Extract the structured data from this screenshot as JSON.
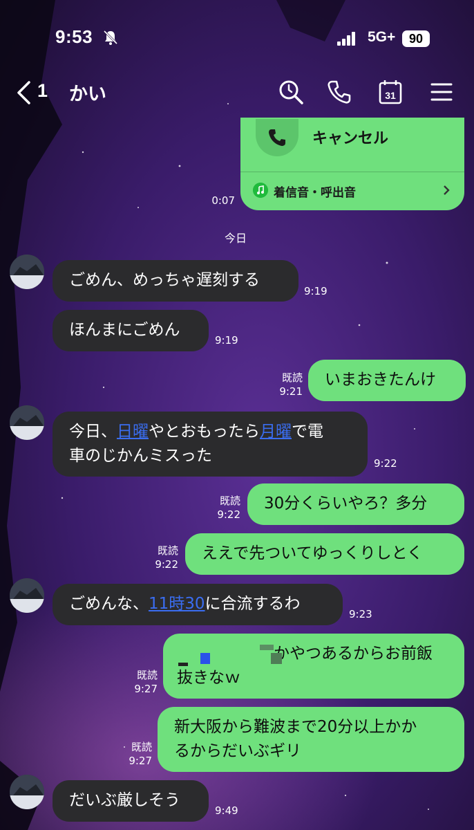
{
  "status_bar": {
    "time": "9:53",
    "network": "5G+",
    "battery": "90"
  },
  "header": {
    "back_count": "1",
    "contact_name": "かい"
  },
  "call_card": {
    "title": "キャンセル",
    "ringtone_label": "着信音・呼出音",
    "time": "0:07"
  },
  "date_separator": "今日",
  "messages": [
    {
      "dir": "in",
      "text": "ごめん、めっちゃ遅刻する",
      "time": "9:19"
    },
    {
      "dir": "in",
      "text": "ほんまにごめん",
      "time": "9:19"
    },
    {
      "dir": "out",
      "text": "いまおきたんけ",
      "read": "既読",
      "time": "9:21"
    },
    {
      "dir": "in",
      "parts": [
        "今日、",
        "日曜",
        "やとおもったら",
        "月曜",
        "で電",
        "車のじかんミスった"
      ],
      "time": "9:22"
    },
    {
      "dir": "out",
      "text": "30分くらいやろ？多分",
      "read": "既読",
      "time": "9:22"
    },
    {
      "dir": "out",
      "text": "ええで先ついてゆっくりしとく",
      "read": "既読",
      "time": "9:22"
    },
    {
      "dir": "in",
      "parts": [
        "ごめんな、",
        "11時30",
        "に合流するわ"
      ],
      "time": "9:23"
    },
    {
      "dir": "out",
      "parts": [
        "かやつあるからお前飯",
        "抜きなｗ"
      ],
      "read": "既読",
      "time": "9:27"
    },
    {
      "dir": "out",
      "parts": [
        "新大阪から難波まで20分以上かか",
        "るからだいぶギリ"
      ],
      "read": "既読",
      "time": "9:27"
    },
    {
      "dir": "in",
      "text": "だいぶ厳しそう",
      "time": "9:49"
    }
  ],
  "colors": {
    "incoming_bubble": "#2b2b2d",
    "outgoing_bubble": "#6fe07d",
    "link": "#3a6df0",
    "background": "#2a1446"
  },
  "icons": [
    "bell-slash-icon",
    "signal-icon",
    "back-chevron-icon",
    "search-icon",
    "phone-icon",
    "calendar-icon",
    "menu-icon",
    "music-note-icon",
    "chevron-right-icon"
  ]
}
